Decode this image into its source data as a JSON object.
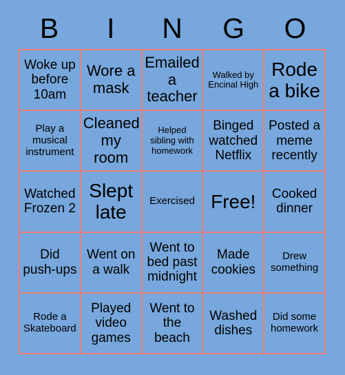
{
  "card": {
    "header_letters": [
      "B",
      "I",
      "N",
      "G",
      "O"
    ],
    "background_color": "#77a7dc",
    "grid_line_color": "#ee8079",
    "text_color": "#000000",
    "rows": 5,
    "columns": 5,
    "cells": [
      {
        "text": "Woke up before 10am",
        "size": "sz-md",
        "free": false
      },
      {
        "text": "Wore a mask",
        "size": "sz-lg",
        "free": false
      },
      {
        "text": "Emailed a teacher",
        "size": "sz-lg",
        "free": false
      },
      {
        "text": "Walked by Encinal High",
        "size": "sz-xs",
        "free": false
      },
      {
        "text": "Rode a bike",
        "size": "sz-xl",
        "free": false
      },
      {
        "text": "Play a musical instrument",
        "size": "sz-sm",
        "free": false
      },
      {
        "text": "Cleaned my room",
        "size": "sz-lg",
        "free": false
      },
      {
        "text": "Helped sibling with homework",
        "size": "sz-xs",
        "free": false
      },
      {
        "text": "Binged watched Netflix",
        "size": "sz-md",
        "free": false
      },
      {
        "text": "Posted a meme recently",
        "size": "sz-md",
        "free": false
      },
      {
        "text": "Watched Frozen 2",
        "size": "sz-md",
        "free": false
      },
      {
        "text": "Slept late",
        "size": "sz-xl",
        "free": false
      },
      {
        "text": "Exercised",
        "size": "sz-sm",
        "free": false
      },
      {
        "text": "Free!",
        "size": "sz-xl",
        "free": true
      },
      {
        "text": "Cooked dinner",
        "size": "sz-md",
        "free": false
      },
      {
        "text": "Did push-ups",
        "size": "sz-md",
        "free": false
      },
      {
        "text": "Went on a walk",
        "size": "sz-md",
        "free": false
      },
      {
        "text": "Went to bed past midnight",
        "size": "sz-md",
        "free": false
      },
      {
        "text": "Made cookies",
        "size": "sz-md",
        "free": false
      },
      {
        "text": "Drew something",
        "size": "sz-sm",
        "free": false
      },
      {
        "text": "Rode a Skateboard",
        "size": "sz-sm",
        "free": false
      },
      {
        "text": "Played video games",
        "size": "sz-md",
        "free": false
      },
      {
        "text": "Went to the beach",
        "size": "sz-md",
        "free": false
      },
      {
        "text": "Washed dishes",
        "size": "sz-md",
        "free": false
      },
      {
        "text": "Did some homework",
        "size": "sz-sm",
        "free": false
      }
    ]
  }
}
